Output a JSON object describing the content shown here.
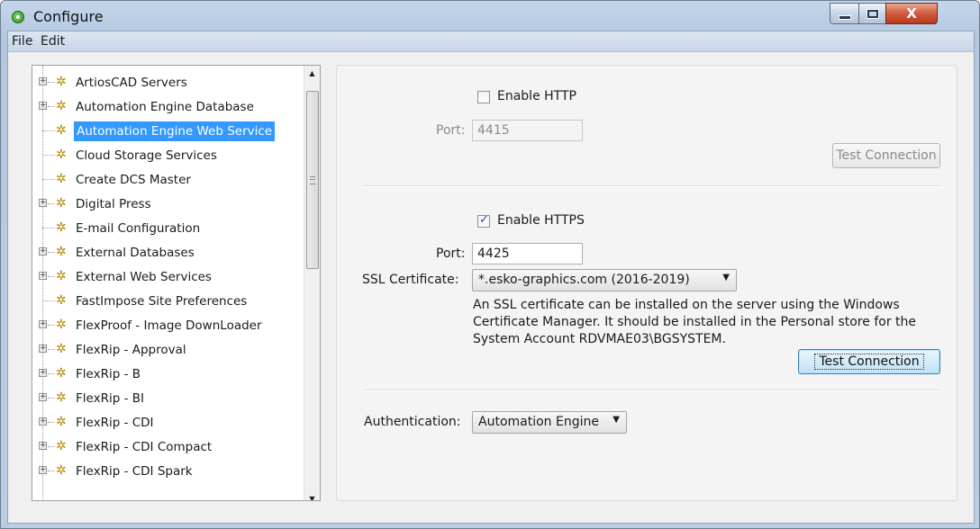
{
  "window": {
    "title": "Configure"
  },
  "menu": {
    "file": "File",
    "edit": "Edit"
  },
  "tree": {
    "items": [
      {
        "label": "ArtiosCAD Servers",
        "expandable": true
      },
      {
        "label": "Automation Engine Database",
        "expandable": true
      },
      {
        "label": "Automation Engine Web Service",
        "expandable": false,
        "selected": true
      },
      {
        "label": "Cloud Storage Services",
        "expandable": false
      },
      {
        "label": "Create DCS Master",
        "expandable": false
      },
      {
        "label": "Digital Press",
        "expandable": true
      },
      {
        "label": "E-mail Configuration",
        "expandable": false
      },
      {
        "label": "External Databases",
        "expandable": true
      },
      {
        "label": "External Web Services",
        "expandable": true
      },
      {
        "label": "FastImpose Site Preferences",
        "expandable": false
      },
      {
        "label": "FlexProof - Image DownLoader",
        "expandable": true
      },
      {
        "label": "FlexRip - Approval",
        "expandable": true
      },
      {
        "label": "FlexRip - B",
        "expandable": true
      },
      {
        "label": "FlexRip - BI",
        "expandable": true
      },
      {
        "label": "FlexRip - CDI",
        "expandable": true
      },
      {
        "label": "FlexRip - CDI Compact",
        "expandable": true
      },
      {
        "label": "FlexRip - CDI Spark",
        "expandable": true
      }
    ]
  },
  "http": {
    "enable_label": "Enable HTTP",
    "enabled": false,
    "port_label": "Port:",
    "port_value": "4415",
    "test_button": "Test Connection"
  },
  "https": {
    "enable_label": "Enable HTTPS",
    "enabled": true,
    "port_label": "Port:",
    "port_value": "4425",
    "ssl_label": "SSL Certificate:",
    "ssl_value": "*.esko-graphics.com (2016-2019)",
    "note_line1": "An SSL certificate can be installed on the server using the Windows",
    "note_line2": "Certificate Manager. It should be installed in the Personal store for the",
    "note_line3": "System Account RDVMAE03\\BGSYSTEM.",
    "test_button": "Test Connection"
  },
  "auth": {
    "label": "Authentication:",
    "value": "Automation Engine"
  },
  "colors": {
    "selection": "#3399ff",
    "title_bar": "#b9cde3",
    "close_button": "#cf5a3d"
  }
}
